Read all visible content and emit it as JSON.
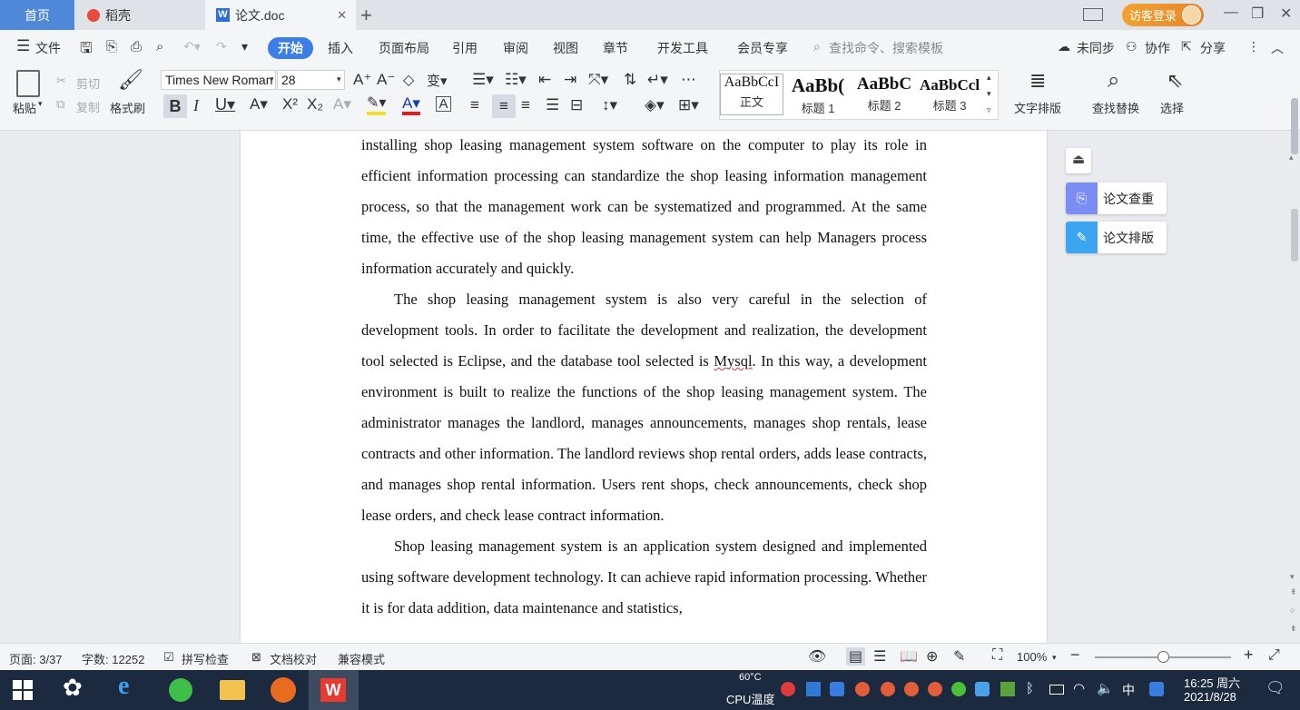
{
  "tabs": {
    "home": "首页",
    "docer": "稻壳",
    "document": "论文.doc",
    "login": "访客登录"
  },
  "menu": {
    "file": "文件",
    "items": [
      "开始",
      "插入",
      "页面布局",
      "引用",
      "审阅",
      "视图",
      "章节",
      "开发工具",
      "会员专享"
    ],
    "search_placeholder": "查找命令、搜索模板",
    "sync": "未同步",
    "collab": "协作",
    "share": "分享"
  },
  "ribbon": {
    "paste": "粘贴",
    "cut": "剪切",
    "copy": "复制",
    "format_painter": "格式刷",
    "font_name": "Times New Roman",
    "font_size": "28",
    "styles": [
      {
        "preview": "AaBbCcI",
        "label": "正文"
      },
      {
        "preview": "AaBb(",
        "label": "标题 1"
      },
      {
        "preview": "AaBbC",
        "label": "标题 2"
      },
      {
        "preview": "AaBbCcl",
        "label": "标题 3"
      }
    ],
    "text_layout": "文字排版",
    "find_replace": "查找替换",
    "select": "选择"
  },
  "side_panel": {
    "check": "论文查重",
    "format": "论文排版"
  },
  "document": {
    "p1": "installing shop leasing management system software on the computer to play its role in efficient information processing can standardize the shop leasing information management process, so that the management work can be systematized and programmed. At the same time, the effective use of the shop leasing management system can help Managers process information accurately and quickly.",
    "p2a": "The shop leasing management system is also very careful in the selection of development tools. In order to facilitate the development and realization, the development tool selected is Eclipse, and the database tool selected is ",
    "p2_mysql": "Mysql",
    "p2b": ". In this way, a development environment is built to realize the functions of the shop leasing management system. The administrator manages the landlord, manages announcements, manages shop rentals, lease contracts and other information. The landlord reviews shop rental orders, adds lease contracts, and manages shop rental information. Users rent shops, check announcements, check shop lease orders, and check lease contract information.",
    "p3": "Shop leasing management system is an application system designed and implemented using software development technology. It can achieve rapid information processing. Whether it is for data addition, data maintenance and statistics,"
  },
  "status": {
    "page": "页面: 3/37",
    "words": "字数: 12252",
    "spell": "拼写检查",
    "proof": "文档校对",
    "compat": "兼容模式",
    "zoom": "100%",
    "zoom_fraction": 0.5
  },
  "taskbar": {
    "cpu_temp": "60°C",
    "cpu_label": "CPU温度",
    "ime": "中",
    "time": "16:25 周六",
    "date": "2021/8/28"
  }
}
